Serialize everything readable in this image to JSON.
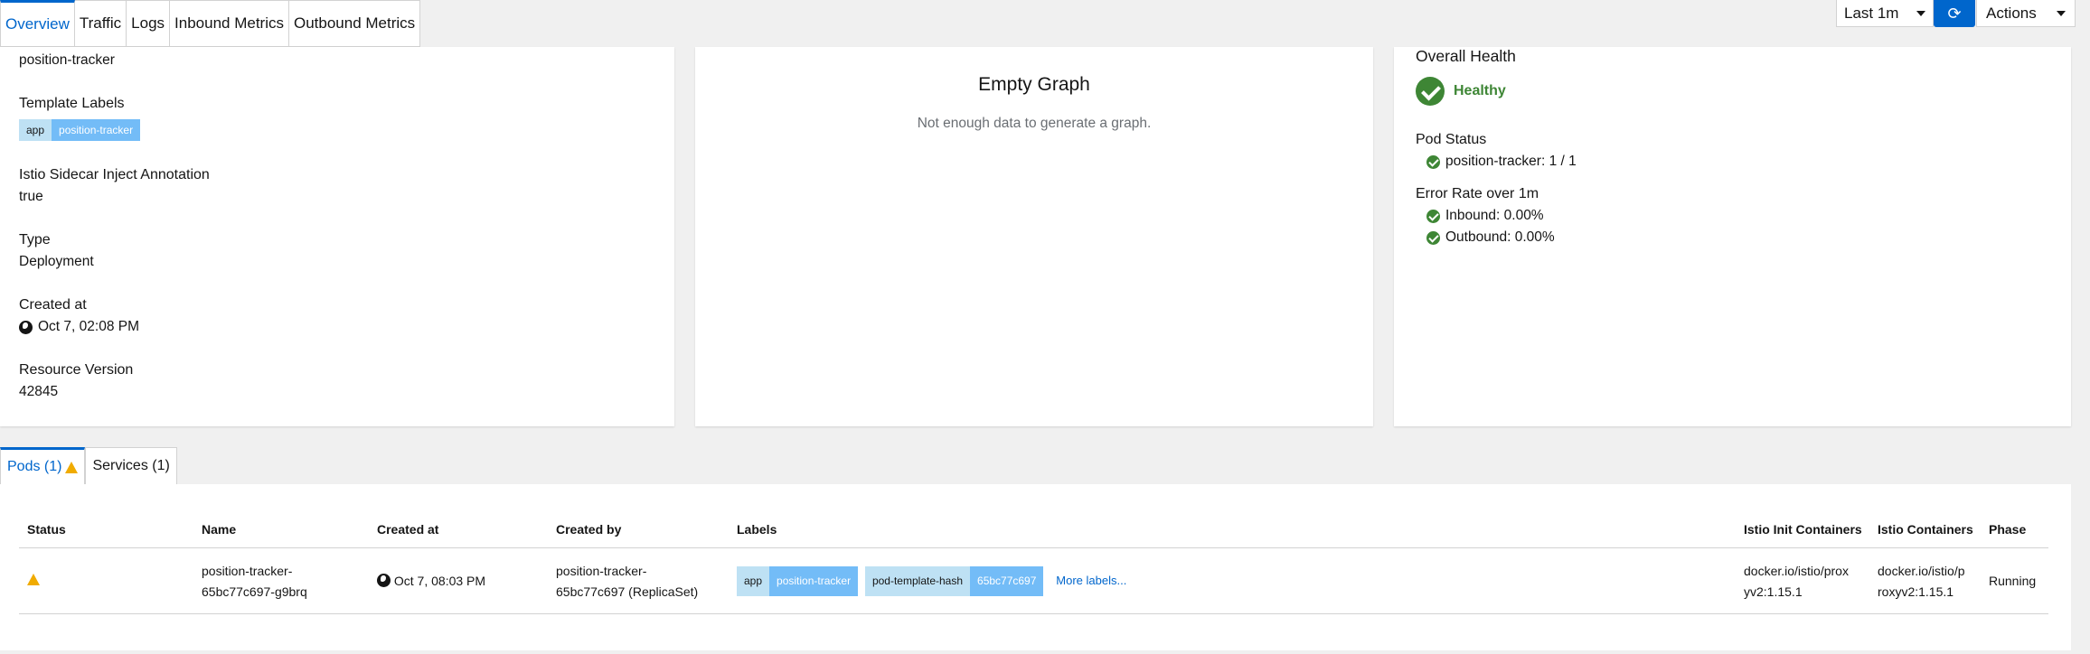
{
  "tabs": [
    "Overview",
    "Traffic",
    "Logs",
    "Inbound Metrics",
    "Outbound Metrics"
  ],
  "toolbar": {
    "range": "Last 1m",
    "refresh_icon": "refresh-icon",
    "actions": "Actions"
  },
  "details": {
    "name_value": "position-tracker",
    "template_labels_title": "Template Labels",
    "template_label": {
      "key": "app",
      "value": "position-tracker"
    },
    "istio_title": "Istio Sidecar Inject Annotation",
    "istio_value": "true",
    "type_title": "Type",
    "type_value": "Deployment",
    "created_title": "Created at",
    "created_value": "Oct 7, 02:08 PM",
    "resource_title": "Resource Version",
    "resource_value": "42845"
  },
  "graph": {
    "title": "Empty Graph",
    "subtitle": "Not enough data to generate a graph."
  },
  "health": {
    "title": "Overall Health",
    "status": "Healthy",
    "status_color": "#3e8635",
    "pod_status_title": "Pod Status",
    "pod_status_item": "position-tracker: 1 / 1",
    "error_title": "Error Rate over 1m",
    "inbound": "Inbound: 0.00%",
    "outbound": "Outbound: 0.00%"
  },
  "bottom_tabs": {
    "pods": "Pods (1)",
    "services": "Services (1)"
  },
  "table": {
    "headers": [
      "Status",
      "Name",
      "Created at",
      "Created by",
      "Labels",
      "Istio Init Containers",
      "Istio Containers",
      "Phase"
    ],
    "row": {
      "name_line1": "position-tracker-",
      "name_line2": "65bc77c697-g9brq",
      "created_at": "Oct 7, 08:03 PM",
      "created_by_line1": "position-tracker-",
      "created_by_line2": "65bc77c697 (ReplicaSet)",
      "label1_key": "app",
      "label1_value": "position-tracker",
      "label2_key": "pod-template-hash",
      "label2_value": "65bc77c697",
      "more": "More labels...",
      "init_line1": "docker.io/istio/prox",
      "init_line2": "yv2:1.15.1",
      "cont_line1": "docker.io/istio/p",
      "cont_line2": "roxyv2:1.15.1",
      "phase": "Running"
    }
  },
  "colors": {
    "accent": "#06c",
    "warning": "#f0ab00",
    "success": "#3e8635"
  }
}
